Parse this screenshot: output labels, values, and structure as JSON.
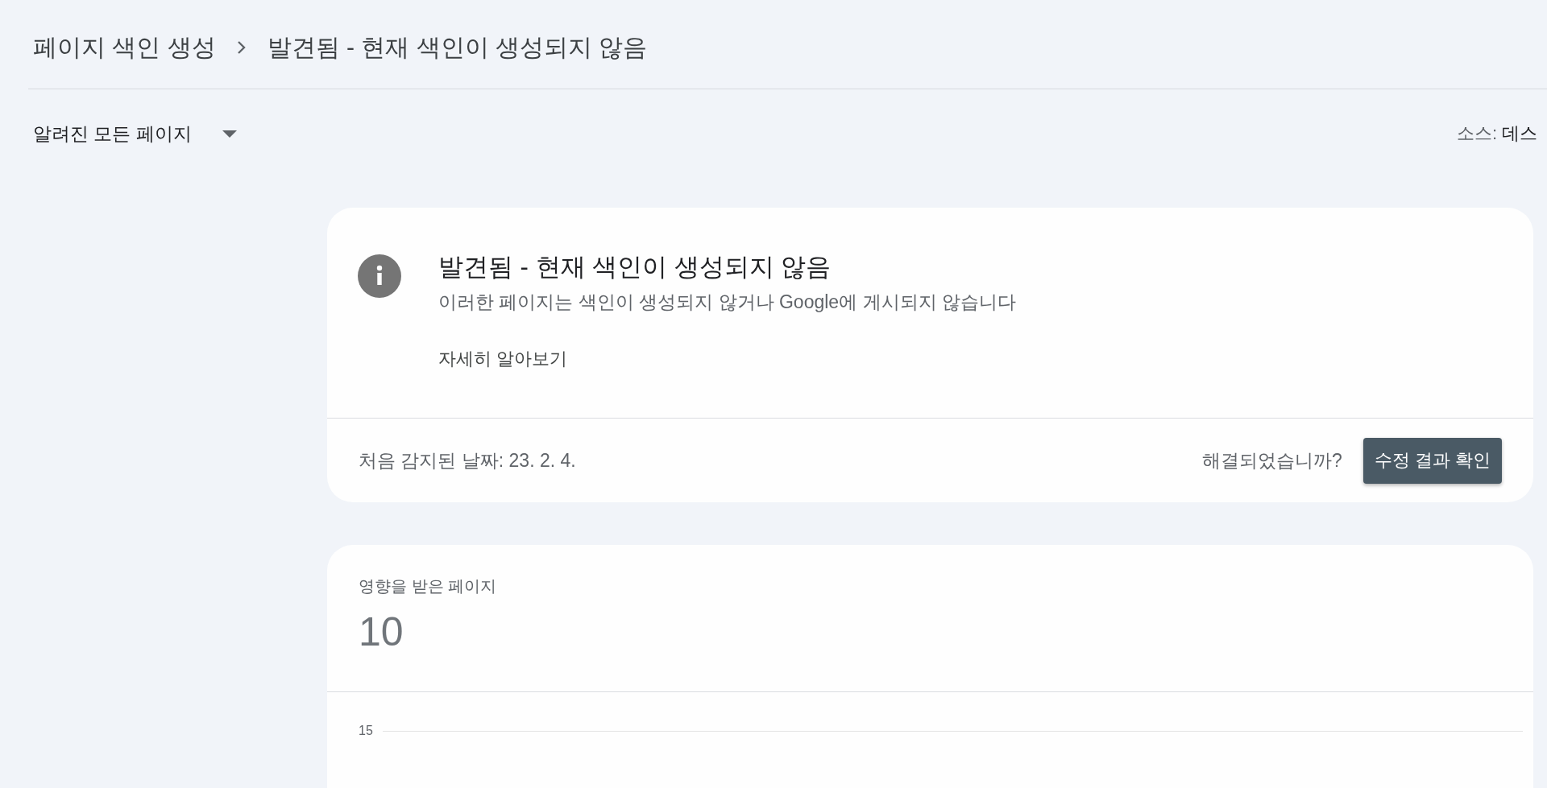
{
  "breadcrumb": {
    "items": [
      {
        "label": "페이지 색인 생성"
      },
      {
        "label": "발견됨 - 현재 색인이 생성되지 않음"
      }
    ]
  },
  "filter": {
    "label": "알려진 모든 페이지"
  },
  "source": {
    "label": "소스:",
    "value": "데스"
  },
  "issue_card": {
    "title": "발견됨 - 현재 색인이 생성되지 않음",
    "description": "이러한 페이지는 색인이 생성되지 않거나 Google에 게시되지 않습니다",
    "link": "자세히 알아보기",
    "first_detected": "처음 감지된 날짜: 23. 2. 4.",
    "question": "해결되었습니까?",
    "button": "수정 결과 확인"
  },
  "affected_card": {
    "label": "영향을 받은 페이지",
    "count": "10",
    "chart": {
      "y_tick_labels": [
        "15"
      ]
    }
  }
}
